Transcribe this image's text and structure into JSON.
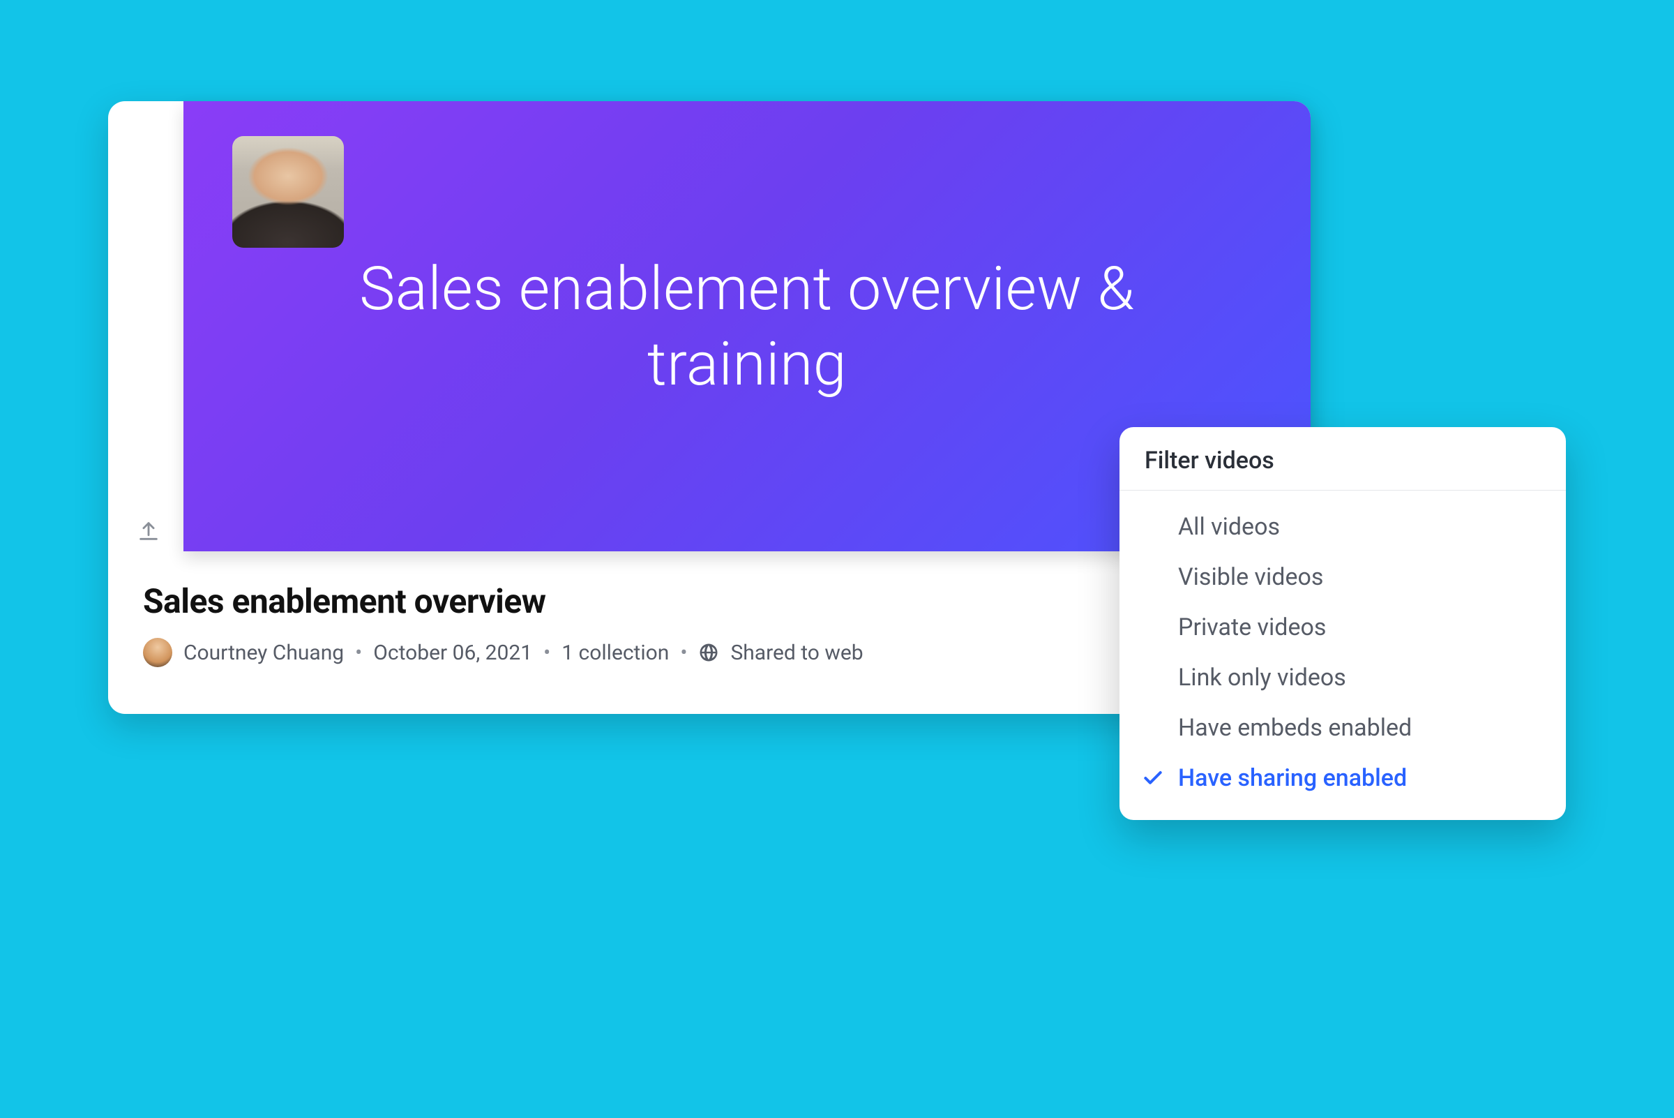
{
  "video": {
    "hero_title": "Sales enablement overview & training",
    "title": "Sales enablement overview",
    "author": "Courtney Chuang",
    "date": "October 06, 2021",
    "collection_text": "1 collection",
    "sharing_status": "Shared to web"
  },
  "meta": {
    "separator": "•"
  },
  "dropdown": {
    "title": "Filter videos",
    "items": [
      {
        "label": "All videos",
        "selected": false
      },
      {
        "label": "Visible videos",
        "selected": false
      },
      {
        "label": "Private videos",
        "selected": false
      },
      {
        "label": "Link only videos",
        "selected": false
      },
      {
        "label": "Have embeds enabled",
        "selected": false
      },
      {
        "label": "Have sharing enabled",
        "selected": true
      }
    ]
  }
}
